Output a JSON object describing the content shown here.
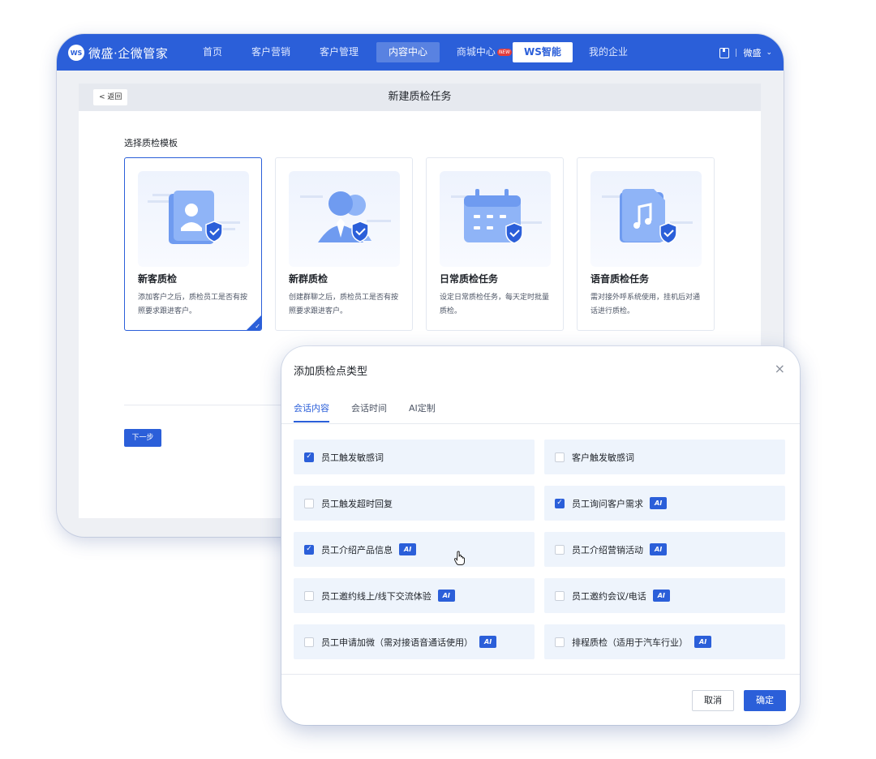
{
  "app": {
    "logo_badge": "WS",
    "logo_text": "微盛·企微管家",
    "nav": [
      {
        "label": "首页"
      },
      {
        "label": "客户营销"
      },
      {
        "label": "客户管理"
      },
      {
        "label": "内容中心"
      },
      {
        "label": "商城中心",
        "badge": "NEW"
      },
      {
        "label": "WS智能"
      },
      {
        "label": "我的企业"
      }
    ],
    "user": "微盛"
  },
  "page": {
    "back_label": "< 返回",
    "title": "新建质检任务",
    "section_label": "选择质检模板",
    "next_label": "下一步",
    "templates": [
      {
        "title": "新客质检",
        "desc": "添加客户之后，质检员工是否有按照要求跟进客户。",
        "icon": "user-document-shield-icon",
        "selected": true
      },
      {
        "title": "新群质检",
        "desc": "创建群聊之后，质检员工是否有按照要求跟进客户。",
        "icon": "group-users-shield-icon",
        "selected": false
      },
      {
        "title": "日常质检任务",
        "desc": "设定日常质检任务，每天定时批量质检。",
        "icon": "calendar-shield-icon",
        "selected": false
      },
      {
        "title": "语音质检任务",
        "desc": "需对接外呼系统使用，挂机后对通话进行质检。",
        "icon": "music-document-shield-icon",
        "selected": false
      }
    ]
  },
  "dialog": {
    "title": "添加质检点类型",
    "tabs": [
      "会话内容",
      "会话时间",
      "AI定制"
    ],
    "active_tab": 0,
    "ai_label": "AI",
    "options": [
      {
        "label": "员工触发敏感词",
        "checked": true,
        "ai": false
      },
      {
        "label": "客户触发敏感词",
        "checked": false,
        "ai": false
      },
      {
        "label": "员工触发超时回复",
        "checked": false,
        "ai": false
      },
      {
        "label": "员工询问客户需求",
        "checked": true,
        "ai": true
      },
      {
        "label": "员工介绍产品信息",
        "checked": true,
        "ai": true
      },
      {
        "label": "员工介绍营销活动",
        "checked": false,
        "ai": true
      },
      {
        "label": "员工邀约线上/线下交流体验",
        "checked": false,
        "ai": true
      },
      {
        "label": "员工邀约会议/电话",
        "checked": false,
        "ai": true
      },
      {
        "label": "员工申请加微（需对接语音通话使用）",
        "checked": false,
        "ai": true
      },
      {
        "label": "排程质检（适用于汽车行业）",
        "checked": false,
        "ai": true
      }
    ],
    "cancel_label": "取消",
    "ok_label": "确定"
  },
  "colors": {
    "brand": "#2b5fd9",
    "option_bg": "#eef4fc"
  }
}
